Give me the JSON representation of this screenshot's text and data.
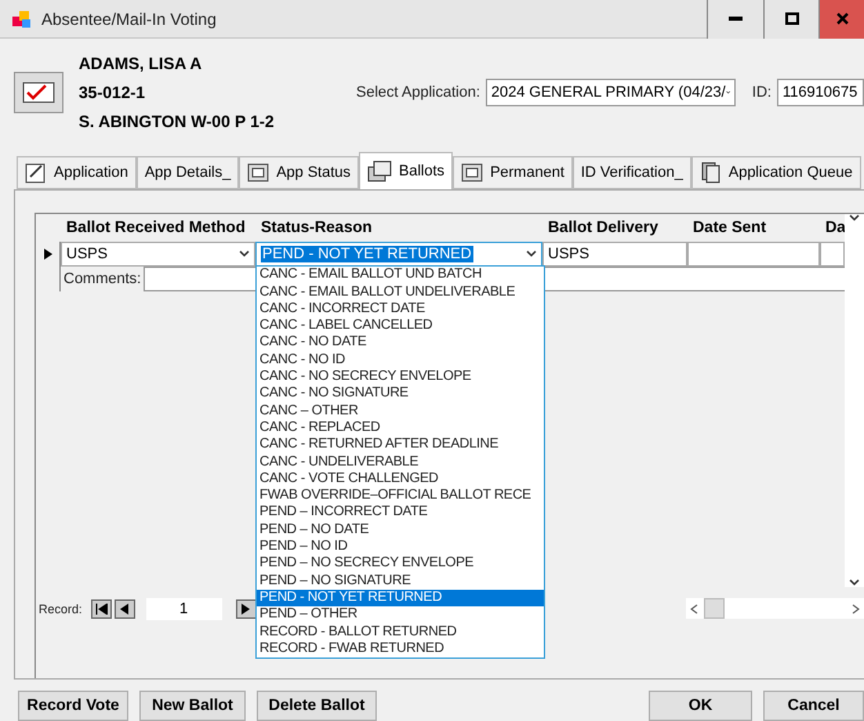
{
  "window": {
    "title": "Absentee/Mail-In Voting"
  },
  "voter": {
    "name": "ADAMS, LISA A",
    "code": "35-012-1",
    "precinct": "S. ABINGTON W-00 P 1-2"
  },
  "application": {
    "label": "Select Application:",
    "value": "2024 GENERAL PRIMARY (04/23/",
    "id_label": "ID:",
    "id_value": "116910675"
  },
  "tabs": [
    {
      "label": "Application",
      "selected": false
    },
    {
      "label": "App Details_",
      "selected": false
    },
    {
      "label": "App Status",
      "selected": false
    },
    {
      "label": "Ballots",
      "selected": true
    },
    {
      "label": "Permanent",
      "selected": false
    },
    {
      "label": "ID Verification_",
      "selected": false
    },
    {
      "label": "Application Queue",
      "selected": false
    }
  ],
  "grid": {
    "columns": [
      "Ballot Received Method",
      "Status-Reason",
      "Ballot Delivery",
      "Date Sent",
      "Da"
    ],
    "row": {
      "method": "USPS",
      "status": "PEND - NOT YET RETURNED",
      "delivery": "USPS"
    },
    "comments_label": "Comments:"
  },
  "status_dropdown": {
    "options": [
      {
        "label": "CANC - EMAIL BALLOT UND BATCH",
        "selected": false
      },
      {
        "label": "CANC - EMAIL BALLOT UNDELIVERABLE",
        "selected": false
      },
      {
        "label": "CANC - INCORRECT DATE",
        "selected": false
      },
      {
        "label": "CANC - LABEL CANCELLED",
        "selected": false
      },
      {
        "label": "CANC - NO DATE",
        "selected": false
      },
      {
        "label": "CANC - NO ID",
        "selected": false
      },
      {
        "label": "CANC - NO SECRECY ENVELOPE",
        "selected": false
      },
      {
        "label": "CANC - NO SIGNATURE",
        "selected": false
      },
      {
        "label": "CANC – OTHER",
        "selected": false
      },
      {
        "label": "CANC - REPLACED",
        "selected": false
      },
      {
        "label": "CANC - RETURNED AFTER DEADLINE",
        "selected": false
      },
      {
        "label": "CANC - UNDELIVERABLE",
        "selected": false
      },
      {
        "label": "CANC - VOTE CHALLENGED",
        "selected": false
      },
      {
        "label": "FWAB OVERRIDE–OFFICIAL BALLOT RECE",
        "selected": false
      },
      {
        "label": "PEND – INCORRECT DATE",
        "selected": false
      },
      {
        "label": "PEND – NO DATE",
        "selected": false
      },
      {
        "label": "PEND – NO ID",
        "selected": false
      },
      {
        "label": "PEND – NO SECRECY ENVELOPE",
        "selected": false
      },
      {
        "label": "PEND – NO SIGNATURE",
        "selected": false
      },
      {
        "label": "PEND - NOT YET RETURNED",
        "selected": true
      },
      {
        "label": "PEND – OTHER",
        "selected": false
      },
      {
        "label": "RECORD - BALLOT RETURNED",
        "selected": false
      },
      {
        "label": "RECORD - FWAB RETURNED",
        "selected": false
      }
    ]
  },
  "record_nav": {
    "label": "Record:",
    "value": "1"
  },
  "buttons_left": [
    "Record Vote",
    "New Ballot",
    "Delete Ballot"
  ],
  "buttons_right": [
    "OK",
    "Cancel"
  ]
}
